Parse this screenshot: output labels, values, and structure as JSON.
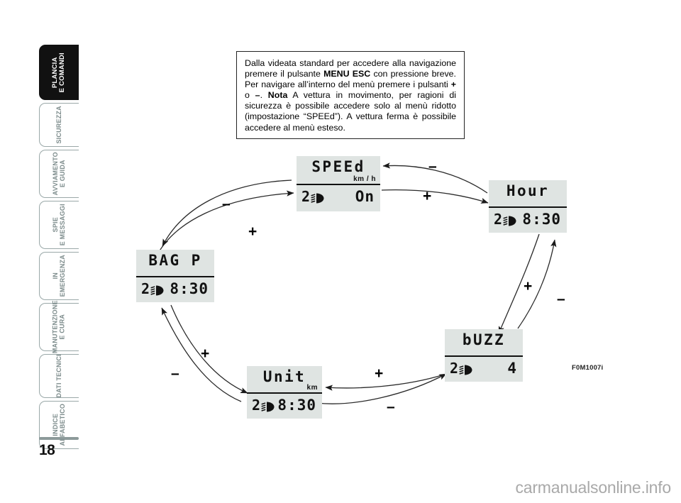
{
  "page": {
    "number": "18",
    "figure_code": "F0M1007i",
    "watermark": "carmanualsonline.info"
  },
  "sidebar": {
    "items": [
      {
        "label": "PLANCIA\nE COMANDI",
        "active": true
      },
      {
        "label": "SICUREZZA",
        "active": false
      },
      {
        "label": "AVVIAMENTO\nE GUIDA",
        "active": false
      },
      {
        "label": "SPIE\nE MESSAGGI",
        "active": false
      },
      {
        "label": "IN\nEMERGENZA",
        "active": false
      },
      {
        "label": "MANUTENZIONE\nE CURA",
        "active": false
      },
      {
        "label": "DATI TECNICI",
        "active": false
      },
      {
        "label": "INDICE\nALFABETICO",
        "active": false
      }
    ]
  },
  "note": {
    "html": "Dalla videata standard per accedere alla navigazione premere il pulsante <b>MENU ESC</b> con pressione breve. Per navigare all’interno del menù premere i pulsanti <b>+</b> o <b>–</b>. <b>Nota</b> A vettura in movimento, per ragioni di sicurezza è possibile accedere solo al menù ridotto (impostazione “SPEEd”). A vettura ferma è possibile accedere al menù esteso."
  },
  "diagram": {
    "lcd_screens": [
      {
        "id": "speed",
        "title": "SPEEd",
        "unit": "km / h",
        "left_digit": "2",
        "left_icon": "low-beam-headlight-icon",
        "value": "On"
      },
      {
        "id": "hour",
        "title": "Hour",
        "unit": "",
        "left_digit": "2",
        "left_icon": "low-beam-headlight-icon",
        "value": "8:30"
      },
      {
        "id": "buzz",
        "title": "bUZZ",
        "unit": "",
        "left_digit": "2",
        "left_icon": "low-beam-headlight-icon",
        "value": "4"
      },
      {
        "id": "unit",
        "title": "Unit",
        "unit": "km",
        "left_digit": "2",
        "left_icon": "low-beam-headlight-icon",
        "value": "8:30"
      },
      {
        "id": "bagp",
        "title": "BAG P",
        "unit": "",
        "left_digit": "2",
        "left_icon": "low-beam-headlight-icon",
        "value": "8:30"
      }
    ],
    "signs": [
      {
        "id": "speed-hour-minus",
        "text": "–"
      },
      {
        "id": "speed-hour-plus",
        "text": "+"
      },
      {
        "id": "hour-buzz-plus",
        "text": "+"
      },
      {
        "id": "hour-buzz-minus",
        "text": "–"
      },
      {
        "id": "buzz-unit-plus",
        "text": "+"
      },
      {
        "id": "buzz-unit-minus",
        "text": "–"
      },
      {
        "id": "unit-bagp-plus",
        "text": "+"
      },
      {
        "id": "unit-bagp-minus",
        "text": "–"
      },
      {
        "id": "bagp-speed-minus",
        "text": "–"
      },
      {
        "id": "bagp-speed-plus",
        "text": "+"
      }
    ]
  }
}
